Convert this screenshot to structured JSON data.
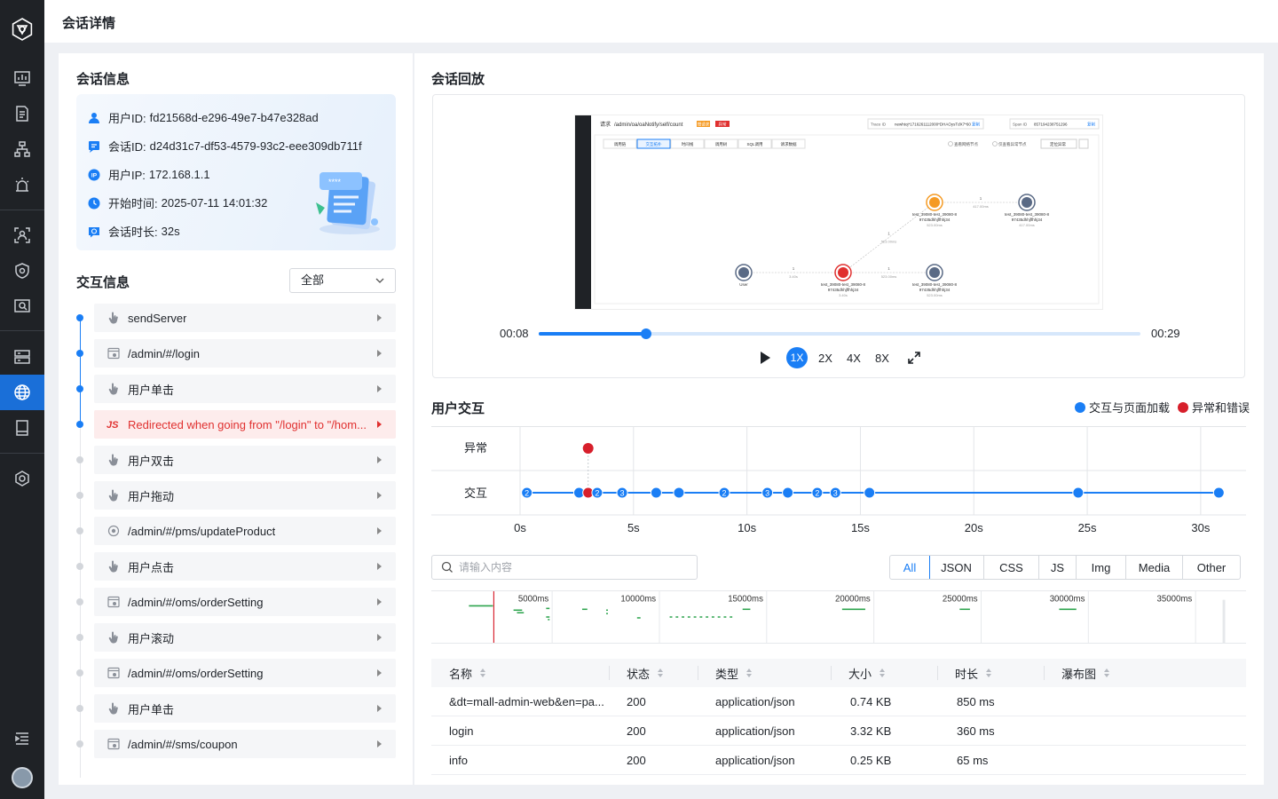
{
  "page_title": "会话详情",
  "session_info": {
    "title": "会话信息",
    "rows": [
      {
        "label": "用户ID:",
        "value": "fd21568d-e296-49e7-b47e328ad",
        "icon": "user-icon"
      },
      {
        "label": "会话ID:",
        "value": "d24d31c7-df53-4579-93c2-eee309db711f",
        "icon": "chat-icon"
      },
      {
        "label": "用户IP:",
        "value": "172.168.1.1",
        "icon": "ip-icon"
      },
      {
        "label": "开始时间:",
        "value": "2025-07-11 14:01:32",
        "icon": "clock-icon"
      },
      {
        "label": "会话时长:",
        "value": "32s",
        "icon": "duration-icon"
      }
    ]
  },
  "interaction_info": {
    "title": "交互信息",
    "filter_value": "全部",
    "items": [
      {
        "icon": "hand-icon",
        "text": "sendServer",
        "active": true,
        "error": false
      },
      {
        "icon": "page-icon",
        "text": "/admin/#/login",
        "active": true,
        "error": false
      },
      {
        "icon": "hand-icon",
        "text": "用户单击",
        "active": true,
        "error": false
      },
      {
        "icon": "js-icon",
        "text": "Redirected when going from \"/login\" to \"/hom...",
        "active": true,
        "error": true
      },
      {
        "icon": "hand-icon",
        "text": "用户双击",
        "active": false,
        "error": false
      },
      {
        "icon": "hand-icon",
        "text": "用户拖动",
        "active": false,
        "error": false
      },
      {
        "icon": "globe-small-icon",
        "text": "/admin/#/pms/updateProduct",
        "active": false,
        "error": false
      },
      {
        "icon": "hand-icon",
        "text": "用户点击",
        "active": false,
        "error": false
      },
      {
        "icon": "page-icon",
        "text": "/admin/#/oms/orderSetting",
        "active": false,
        "error": false
      },
      {
        "icon": "hand-icon",
        "text": "用户滚动",
        "active": false,
        "error": false
      },
      {
        "icon": "page-icon",
        "text": "/admin/#/oms/orderSetting",
        "active": false,
        "error": false
      },
      {
        "icon": "hand-icon",
        "text": "用户单击",
        "active": false,
        "error": false
      },
      {
        "icon": "page-icon",
        "text": "/admin/#/sms/coupon",
        "active": false,
        "error": false
      }
    ]
  },
  "replay": {
    "title": "会话回放",
    "current_time": "00:08",
    "total_time": "00:29",
    "progress": 0.178,
    "speeds": [
      "1X",
      "2X",
      "4X",
      "8X"
    ],
    "active_speed": "1X",
    "screenshot": {
      "request_label": "请求",
      "request_path": "/admin/oa/oaNotify/self/count",
      "badge_a": "慢请求",
      "badge_b": "异常",
      "trace_label": "Trace ID",
      "trace_value": "newhtoj*1716261112000*DHAOysTdX7*60",
      "copy": "复制",
      "span_label": "Span ID",
      "span_value": "857194238751296",
      "tabs": [
        "调用链",
        "交互拓扑",
        "时间线",
        "调用树",
        "SQL调用",
        "请求数据"
      ],
      "active_tab": "交互拓扑",
      "opt_a": "查看网络节点",
      "opt_b": "仅查看异常节点",
      "locate": "定位异常",
      "nodes": [
        {
          "name": "User",
          "sub": "",
          "val": ""
        },
        {
          "name": "test_39080-test_39080-8",
          "sub": "97435dhhjffhhj34",
          "val": "3.40s"
        },
        {
          "name": "test_39080-test_39080-8",
          "sub": "97435dhhjffhhj34",
          "val": "523.00ms"
        },
        {
          "name": "test_39080-test_39080-8",
          "sub": "97435dhhjffhhj34",
          "val": "523.00ms"
        },
        {
          "name": "test_39080-test_39080-8",
          "sub": "97435dhhjffhhj34",
          "val": "417.00ms"
        }
      ],
      "edges": [
        {
          "count": "1",
          "val": "3.40s"
        },
        {
          "count": "1",
          "val": "523.00ms"
        },
        {
          "count": "1",
          "val": "523.00ms"
        },
        {
          "count": "1",
          "val": "417.00ms"
        }
      ]
    }
  },
  "user_interaction": {
    "title": "用户交互",
    "legend": [
      {
        "label": "交互与页面加载",
        "color": "#1a7ef5"
      },
      {
        "label": "异常和错误",
        "color": "#d71f2b"
      }
    ],
    "row_labels": [
      "异常",
      "交互"
    ],
    "x_ticks": [
      "0s",
      "5s",
      "10s",
      "15s",
      "20s",
      "25s",
      "30s"
    ],
    "x_max": 32,
    "error_points": [
      3.0
    ],
    "interaction_points": [
      {
        "t": 0.3,
        "label": "2"
      },
      {
        "t": 2.6,
        "label": ""
      },
      {
        "t": 3.0,
        "label": "",
        "error": true
      },
      {
        "t": 3.4,
        "label": "2"
      },
      {
        "t": 4.5,
        "label": "3"
      },
      {
        "t": 6.0,
        "label": ""
      },
      {
        "t": 7.0,
        "label": ""
      },
      {
        "t": 9.0,
        "label": "2"
      },
      {
        "t": 10.9,
        "label": "3"
      },
      {
        "t": 11.8,
        "label": ""
      },
      {
        "t": 13.1,
        "label": "2"
      },
      {
        "t": 13.9,
        "label": "3"
      },
      {
        "t": 15.4,
        "label": ""
      },
      {
        "t": 24.6,
        "label": ""
      },
      {
        "t": 30.8,
        "label": ""
      }
    ]
  },
  "network": {
    "search_placeholder": "请输入内容",
    "type_tabs": [
      "All",
      "JSON",
      "CSS",
      "JS",
      "Img",
      "Media",
      "Other"
    ],
    "active_type": "All",
    "waterfall_ticks": [
      "5000ms",
      "10000ms",
      "15000ms",
      "20000ms",
      "25000ms",
      "30000ms",
      "35000ms"
    ],
    "columns": [
      "名称",
      "状态",
      "类型",
      "大小",
      "时长",
      "瀑布图"
    ],
    "rows": [
      {
        "name": "&dt=mall-admin-web&en=pa...",
        "status": "200",
        "type": "application/json",
        "size": "0.74 KB",
        "duration": "850 ms"
      },
      {
        "name": "login",
        "status": "200",
        "type": "application/json",
        "size": "3.32 KB",
        "duration": "360 ms"
      },
      {
        "name": "info",
        "status": "200",
        "type": "application/json",
        "size": "0.25 KB",
        "duration": "65 ms"
      }
    ]
  },
  "colors": {
    "accent": "#1a7ef5",
    "error": "#d71f2b",
    "sidebar": "#1f2226"
  }
}
